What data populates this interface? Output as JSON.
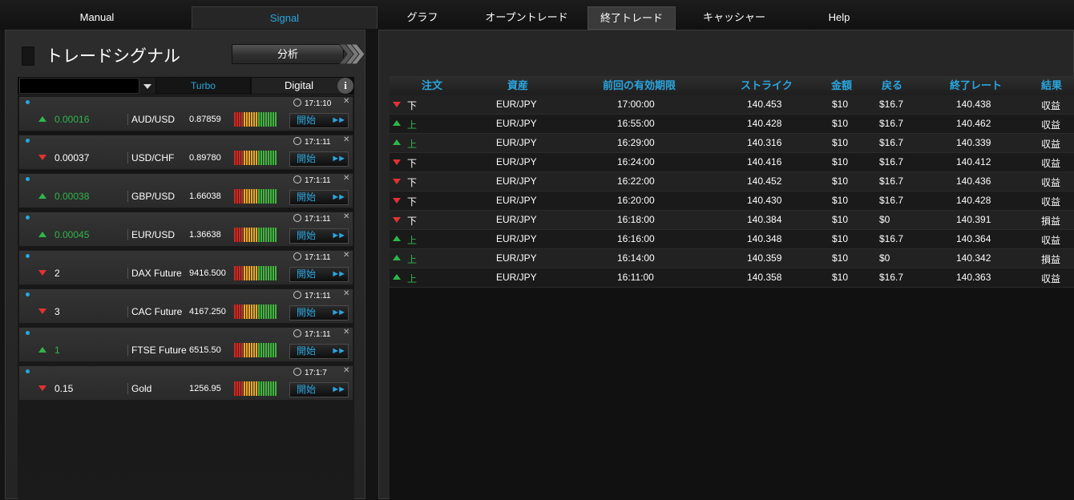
{
  "nav": {
    "tabs": [
      {
        "label": "Manual"
      },
      {
        "label": "Signal"
      },
      {
        "label": "グラフ"
      },
      {
        "label": "オープントレード"
      },
      {
        "label": "終了トレード"
      },
      {
        "label": "キャッシャー"
      },
      {
        "label": "Help"
      }
    ],
    "active_tab": "終了トレード",
    "accent_color": "#2aa6df"
  },
  "signal_panel": {
    "title": "トレードシグナル",
    "analyze_label": "分析",
    "filter_value": "",
    "tabs": [
      {
        "label": "Turbo"
      },
      {
        "label": "Digital"
      }
    ],
    "selected_tab": "Turbo",
    "info_label": "i",
    "signals": [
      {
        "direction": "up",
        "change": "0.00016",
        "symbol": "AUD/USD",
        "price": "0.87859",
        "time": "17:1:10",
        "start_label": "開始"
      },
      {
        "direction": "down",
        "change": "0.00037",
        "symbol": "USD/CHF",
        "price": "0.89780",
        "time": "17:1:11",
        "start_label": "開始"
      },
      {
        "direction": "up",
        "change": "0.00038",
        "symbol": "GBP/USD",
        "price": "1.66038",
        "time": "17:1:11",
        "start_label": "開始"
      },
      {
        "direction": "up",
        "change": "0.00045",
        "symbol": "EUR/USD",
        "price": "1.36638",
        "time": "17:1:11",
        "start_label": "開始"
      },
      {
        "direction": "down",
        "change": "2",
        "symbol": "DAX Future",
        "price": "9416.500",
        "time": "17:1:11",
        "start_label": "開始"
      },
      {
        "direction": "down",
        "change": "3",
        "symbol": "CAC Future",
        "price": "4167.250",
        "time": "17:1:11",
        "start_label": "開始"
      },
      {
        "direction": "up",
        "change": "1",
        "symbol": "FTSE Future",
        "price": "6515.50",
        "time": "17:1:11",
        "start_label": "開始"
      },
      {
        "direction": "down",
        "change": "0.15",
        "symbol": "Gold",
        "price": "1256.95",
        "time": "17:1:7",
        "start_label": "開始"
      }
    ]
  },
  "closed_trades": {
    "columns": [
      "注文",
      "資産",
      "前回の有効期限",
      "ストライク",
      "金額",
      "戻る",
      "終了レート",
      "結果"
    ],
    "rows": [
      {
        "direction": "down",
        "order": "下",
        "asset": "EUR/JPY",
        "expiry": "17:00:00",
        "strike": "140.453",
        "amount": "$10",
        "return": "$16.7",
        "close_rate": "140.438",
        "result": "収益"
      },
      {
        "direction": "up",
        "order": "上",
        "asset": "EUR/JPY",
        "expiry": "16:55:00",
        "strike": "140.428",
        "amount": "$10",
        "return": "$16.7",
        "close_rate": "140.462",
        "result": "収益"
      },
      {
        "direction": "up",
        "order": "上",
        "asset": "EUR/JPY",
        "expiry": "16:29:00",
        "strike": "140.316",
        "amount": "$10",
        "return": "$16.7",
        "close_rate": "140.339",
        "result": "収益"
      },
      {
        "direction": "down",
        "order": "下",
        "asset": "EUR/JPY",
        "expiry": "16:24:00",
        "strike": "140.416",
        "amount": "$10",
        "return": "$16.7",
        "close_rate": "140.412",
        "result": "収益"
      },
      {
        "direction": "down",
        "order": "下",
        "asset": "EUR/JPY",
        "expiry": "16:22:00",
        "strike": "140.452",
        "amount": "$10",
        "return": "$16.7",
        "close_rate": "140.436",
        "result": "収益"
      },
      {
        "direction": "down",
        "order": "下",
        "asset": "EUR/JPY",
        "expiry": "16:20:00",
        "strike": "140.430",
        "amount": "$10",
        "return": "$16.7",
        "close_rate": "140.428",
        "result": "収益"
      },
      {
        "direction": "down",
        "order": "下",
        "asset": "EUR/JPY",
        "expiry": "16:18:00",
        "strike": "140.384",
        "amount": "$10",
        "return": "$0",
        "close_rate": "140.391",
        "result": "損益"
      },
      {
        "direction": "up",
        "order": "上",
        "asset": "EUR/JPY",
        "expiry": "16:16:00",
        "strike": "140.348",
        "amount": "$10",
        "return": "$16.7",
        "close_rate": "140.364",
        "result": "収益"
      },
      {
        "direction": "up",
        "order": "上",
        "asset": "EUR/JPY",
        "expiry": "16:14:00",
        "strike": "140.359",
        "amount": "$10",
        "return": "$0",
        "close_rate": "140.342",
        "result": "損益"
      },
      {
        "direction": "up",
        "order": "上",
        "asset": "EUR/JPY",
        "expiry": "16:11:00",
        "strike": "140.358",
        "amount": "$10",
        "return": "$16.7",
        "close_rate": "140.363",
        "result": "収益"
      }
    ]
  },
  "colors": {
    "up": "#2fb54a",
    "down": "#e23232",
    "meter_red": "#d9251d",
    "meter_orange": "#f0a820",
    "meter_green": "#3fb83c"
  }
}
